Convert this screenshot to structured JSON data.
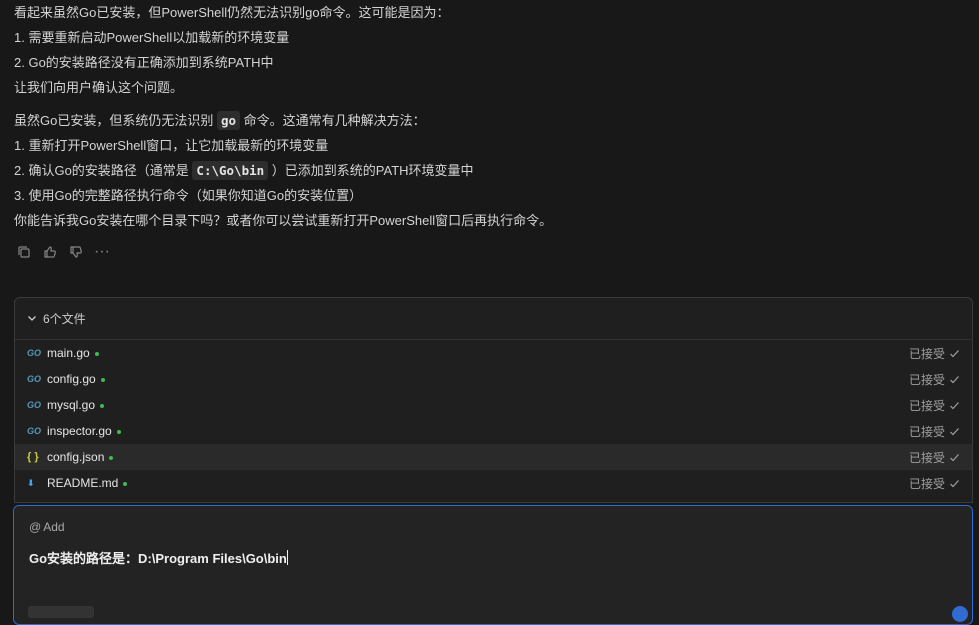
{
  "message": {
    "line1": "看起来虽然Go已安装，但PowerShell仍然无法识别go命令。这可能是因为：",
    "line2": "1. 需要重新启动PowerShell以加载新的环境变量",
    "line3": "2. Go的安装路径没有正确添加到系统PATH中",
    "line4": "让我们向用户确认这个问题。",
    "line5_pre": "虽然Go已安装，但系统仍无法识别",
    "line5_code": "go",
    "line5_post": "命令。这通常有几种解决方法：",
    "line6": "1. 重新打开PowerShell窗口，让它加载最新的环境变量",
    "line7_pre": "2. 确认Go的安装路径（通常是",
    "line7_code": "C:\\Go\\bin",
    "line7_post": "）已添加到系统的PATH环境变量中",
    "line8": "3. 使用Go的完整路径执行命令（如果你知道Go的安装位置）",
    "line9": "你能告诉我Go安装在哪个目录下吗？或者你可以尝试重新打开PowerShell窗口后再执行命令。"
  },
  "actions": {
    "icons": [
      "copy-icon",
      "thumbs-up-icon",
      "thumbs-down-icon",
      "more-icon"
    ],
    "more_glyph": "···"
  },
  "files": {
    "header": "6个文件",
    "items": [
      {
        "name": "main.go",
        "icon": "GO",
        "status": "已接受"
      },
      {
        "name": "config.go",
        "icon": "GO",
        "status": "已接受"
      },
      {
        "name": "mysql.go",
        "icon": "GO",
        "status": "已接受"
      },
      {
        "name": "inspector.go",
        "icon": "GO",
        "status": "已接受"
      },
      {
        "name": "config.json",
        "icon": "{ }",
        "status": "已接受"
      },
      {
        "name": "README.md",
        "icon": "⬇",
        "status": "已接受"
      }
    ]
  },
  "composer": {
    "add_label": "Add",
    "at_symbol": "@",
    "input_value": "Go安装的路径是：D:\\Program Files\\Go\\bin"
  },
  "colors": {
    "accent": "#2f6bd1",
    "go_icon": "#519aba",
    "json_icon": "#cbcb41",
    "md_icon": "#42a5f5",
    "dot_green": "#3fb950"
  }
}
